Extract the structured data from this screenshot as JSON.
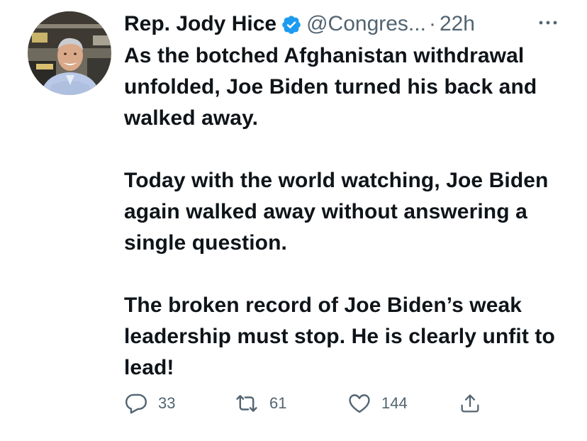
{
  "tweet": {
    "author": {
      "display_name": "Rep. Jody Hice",
      "verified": true,
      "verified_icon": "verified-badge-icon",
      "handle": "@Congres...",
      "avatar": "profile-photo"
    },
    "separator": "·",
    "time": "22h",
    "more_icon": "more-options-icon",
    "paragraphs": [
      "As the botched Afghanistan withdrawal unfolded, Joe Biden turned his back and walked away.",
      "Today with the world watching, Joe Biden again walked away without answering a single question.",
      "The broken record of Joe Biden’s weak leadership must stop. He is clearly unfit to lead!"
    ],
    "actions": {
      "reply": {
        "icon": "reply-icon",
        "count": "33"
      },
      "retweet": {
        "icon": "retweet-icon",
        "count": "61"
      },
      "like": {
        "icon": "heart-icon",
        "count": "144"
      },
      "share": {
        "icon": "share-icon"
      }
    }
  },
  "colors": {
    "text": "#0f1419",
    "secondary": "#536471",
    "verified": "#1d9bf0",
    "background": "#ffffff"
  }
}
